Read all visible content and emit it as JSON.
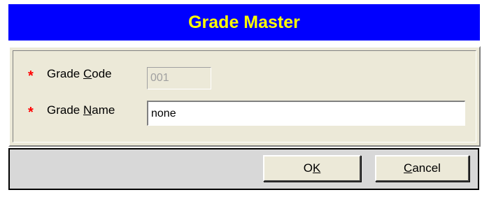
{
  "window": {
    "title": "Grade Master"
  },
  "form": {
    "grade_code": {
      "required_marker": "*",
      "label_pre": "Grade ",
      "label_mnemonic": "C",
      "label_post": "ode",
      "value": "001"
    },
    "grade_name": {
      "required_marker": "*",
      "label_pre": "Grade ",
      "label_mnemonic": "N",
      "label_post": "ame",
      "value": "none"
    }
  },
  "buttons": {
    "ok": {
      "pre": "O",
      "mnemonic": "K",
      "post": ""
    },
    "cancel": {
      "pre": "",
      "mnemonic": "C",
      "post": "ancel"
    }
  },
  "colors": {
    "title_bg": "#0000ff",
    "title_text": "#ffff00",
    "required_marker": "#ff0000",
    "panel_bg": "#ece9d8",
    "button_bar_bg": "#d8d8d8"
  }
}
